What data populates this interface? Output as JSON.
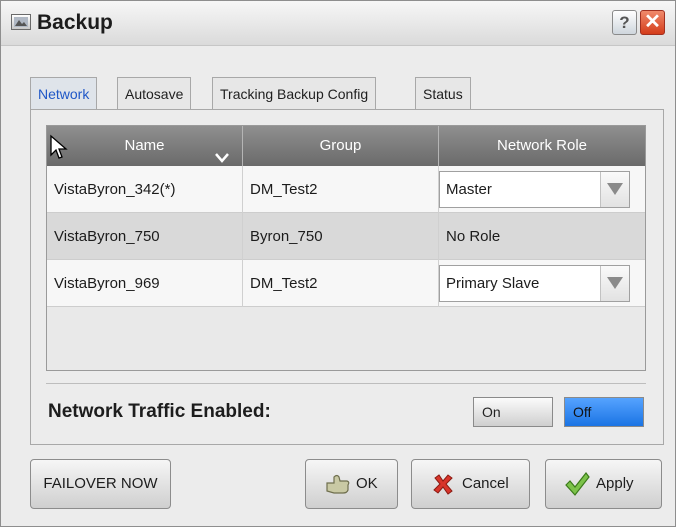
{
  "window": {
    "title": "Backup",
    "help_label": "?",
    "close_label": "✕"
  },
  "tabs": [
    {
      "label": "Network",
      "active": true
    },
    {
      "label": "Autosave",
      "active": false
    },
    {
      "label": "Tracking Backup Config",
      "active": false
    },
    {
      "label": "Status",
      "active": false
    }
  ],
  "table": {
    "columns": [
      "Name",
      "Group",
      "Network Role"
    ],
    "rows": [
      {
        "name": "VistaByron_342(*)",
        "group": "DM_Test2",
        "role": "Master",
        "role_is_dropdown": true
      },
      {
        "name": "VistaByron_750",
        "group": "Byron_750",
        "role": "No Role",
        "role_is_dropdown": false
      },
      {
        "name": "VistaByron_969",
        "group": "DM_Test2",
        "role": "Primary Slave",
        "role_is_dropdown": true
      }
    ]
  },
  "traffic": {
    "label": "Network Traffic Enabled:",
    "on_label": "On",
    "off_label": "Off",
    "selected": "Off"
  },
  "buttons": {
    "failover": "FAILOVER NOW",
    "ok": "OK",
    "cancel": "Cancel",
    "apply": "Apply"
  },
  "colors": {
    "accent": "#1f57c7",
    "toggle_selected": "#2d86f0",
    "header_bg": "#7d7d7d"
  }
}
